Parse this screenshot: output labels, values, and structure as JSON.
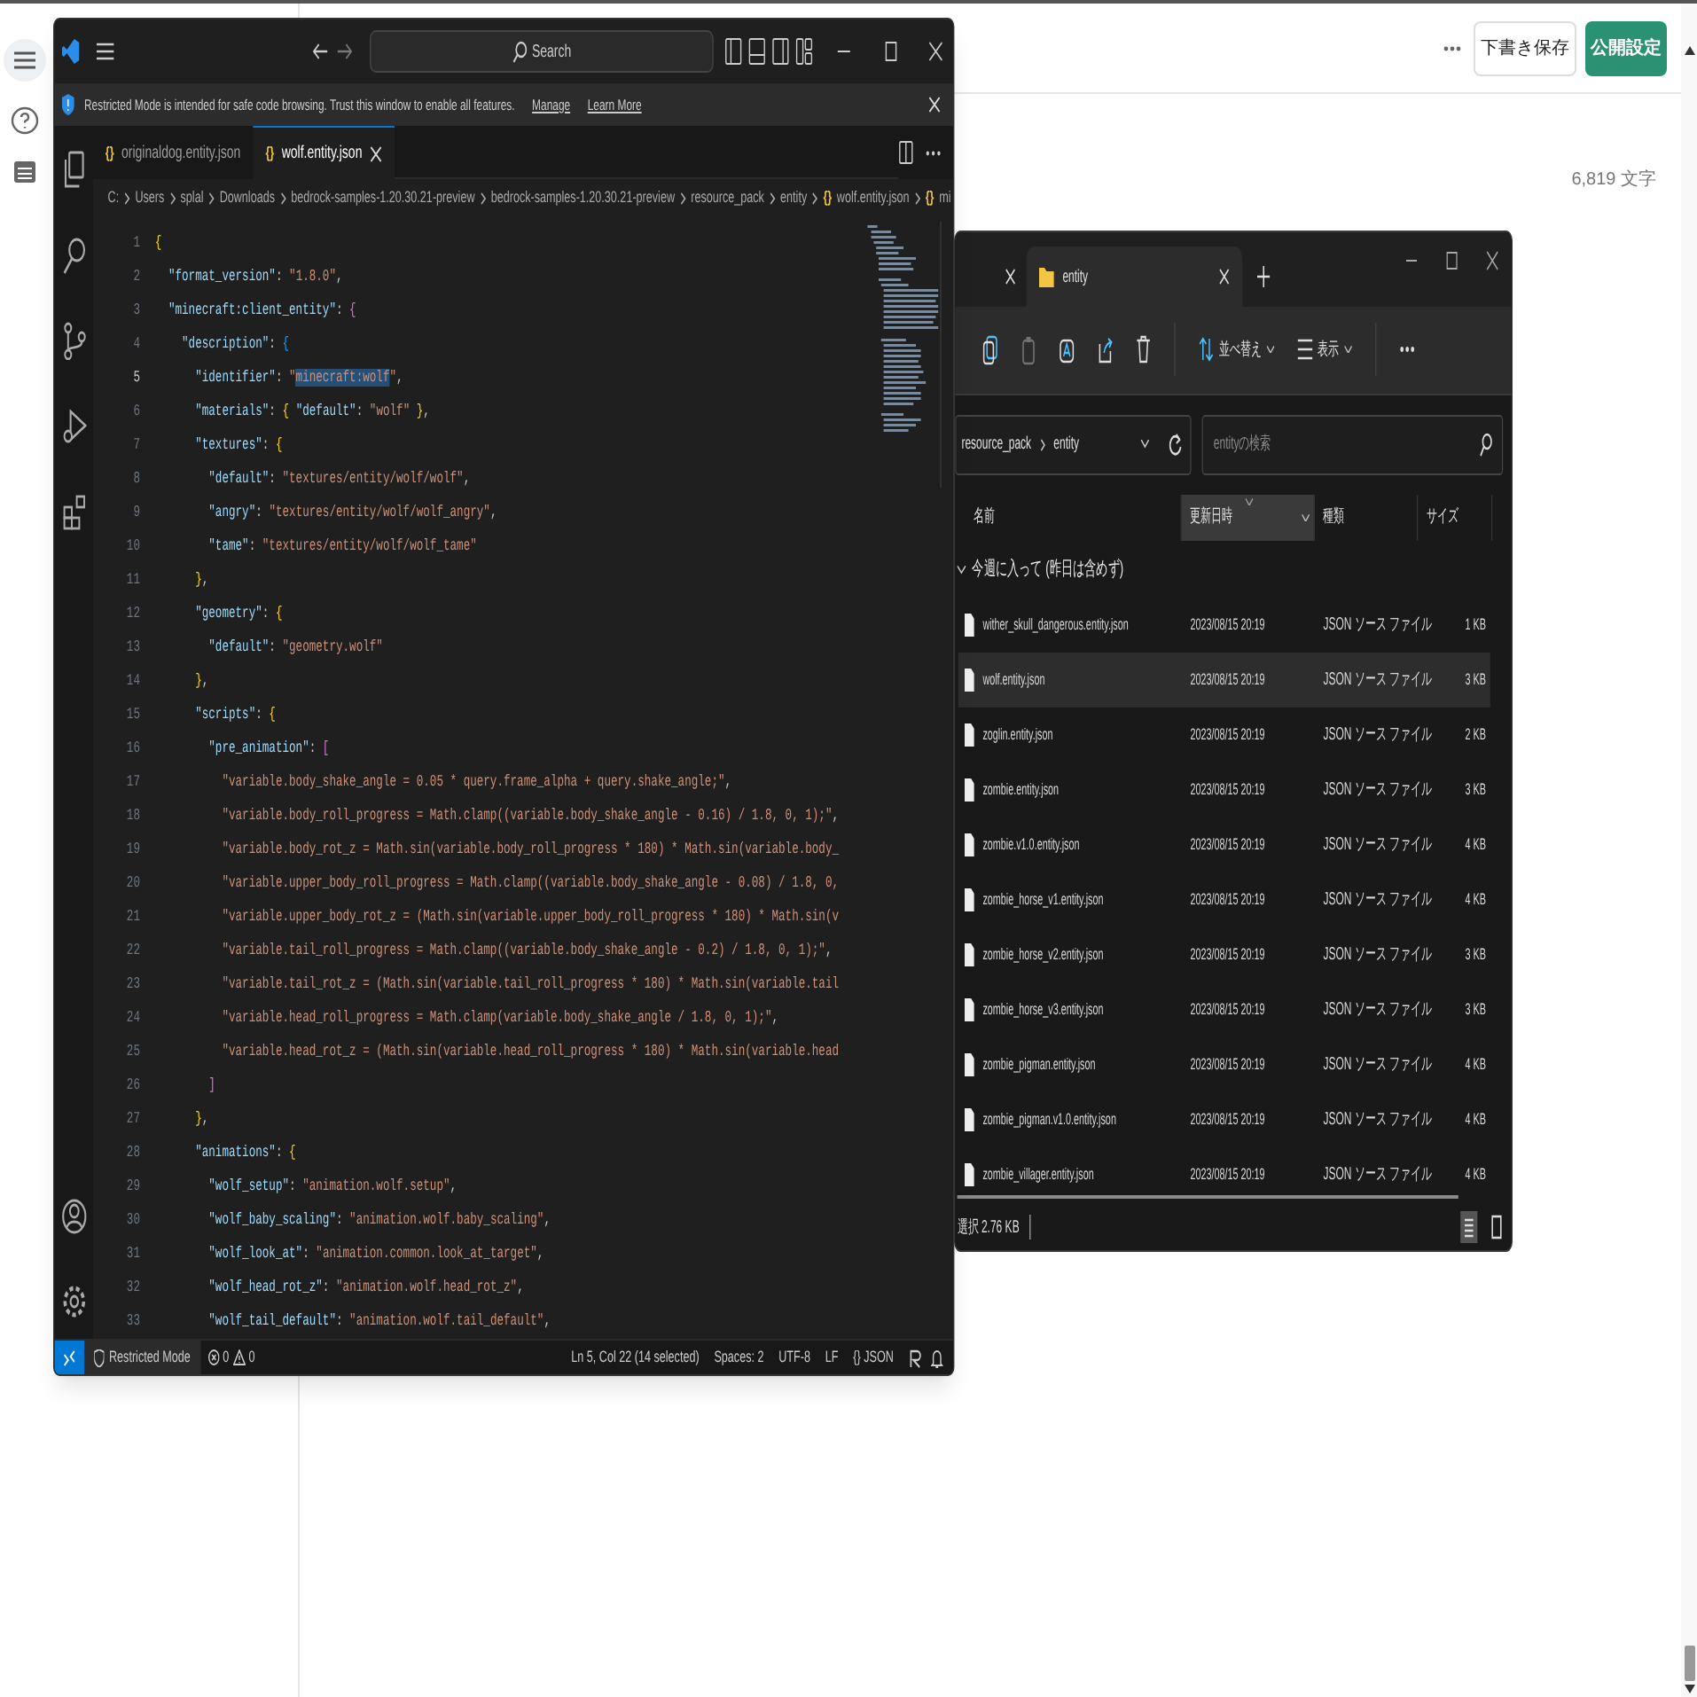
{
  "page": {
    "save_draft": "下書き保存",
    "publish": "公開設定",
    "char_count": "6,819 文字"
  },
  "vscode": {
    "search": "Search",
    "banner": {
      "message": "Restricted Mode is intended for safe code browsing. Trust this window to enable all features.",
      "links": [
        "Manage",
        "Learn More"
      ]
    },
    "tabs": [
      {
        "icon": "{}",
        "label": "originaldog.entity.json",
        "selected": false
      },
      {
        "icon": "{}",
        "label": "wolf.entity.json",
        "selected": true
      }
    ],
    "breadcrumb": [
      {
        "label": "C:"
      },
      {
        "label": "Users"
      },
      {
        "label": "splal"
      },
      {
        "label": "Downloads"
      },
      {
        "label": "bedrock-samples-1.20.30.21-preview"
      },
      {
        "label": "bedrock-samples-1.20.30.21-preview"
      },
      {
        "label": "resource_pack"
      },
      {
        "label": "entity"
      },
      {
        "icon": "{}",
        "label": "wolf.entity.json"
      },
      {
        "icon": "{}",
        "label": "mi"
      }
    ],
    "lines": [
      {
        "number": "1",
        "code": "{"
      },
      {
        "number": "2",
        "code": "  \"format_version\": \"1.8.0\","
      },
      {
        "number": "3",
        "code": "  \"minecraft:client_entity\": {"
      },
      {
        "number": "4",
        "code": "    \"description\": {"
      },
      {
        "number": "5",
        "kind": "selection",
        "code_before": "      \"identifier\": \"",
        "selected_text": "minecraft:wolf",
        "code_after": "\","
      },
      {
        "number": "6",
        "code": "      \"materials\": { \"default\": \"wolf\" },"
      },
      {
        "number": "7",
        "code": "      \"textures\": {"
      },
      {
        "number": "8",
        "code": "        \"default\": \"textures/entity/wolf/wolf\","
      },
      {
        "number": "9",
        "code": "        \"angry\": \"textures/entity/wolf/wolf_angry\","
      },
      {
        "number": "10",
        "code": "        \"tame\": \"textures/entity/wolf/wolf_tame\""
      },
      {
        "number": "11",
        "code": "      },"
      },
      {
        "number": "12",
        "code": "      \"geometry\": {"
      },
      {
        "number": "13",
        "code": "        \"default\": \"geometry.wolf\""
      },
      {
        "number": "14",
        "code": "      },"
      },
      {
        "number": "15",
        "code": "      \"scripts\": {"
      },
      {
        "number": "16",
        "code": "        \"pre_animation\": ["
      },
      {
        "number": "17",
        "code": "          \"variable.body_shake_angle = 0.05 * query.frame_alpha + query.shake_angle;\","
      },
      {
        "number": "18",
        "code": "          \"variable.body_roll_progress = Math.clamp((variable.body_shake_angle - 0.16) / 1.8, 0, 1);\","
      },
      {
        "number": "19",
        "code": "          \"variable.body_rot_z = Math.sin(variable.body_roll_progress * 180) * Math.sin(variable.body_"
      },
      {
        "number": "20",
        "code": "          \"variable.upper_body_roll_progress = Math.clamp((variable.body_shake_angle - 0.08) / 1.8, 0,"
      },
      {
        "number": "21",
        "code": "          \"variable.upper_body_rot_z = (Math.sin(variable.upper_body_roll_progress * 180) * Math.sin(v"
      },
      {
        "number": "22",
        "code": "          \"variable.tail_roll_progress = Math.clamp((variable.body_shake_angle - 0.2) / 1.8, 0, 1);\","
      },
      {
        "number": "23",
        "code": "          \"variable.tail_rot_z = (Math.sin(variable.tail_roll_progress * 180) * Math.sin(variable.tail"
      },
      {
        "number": "24",
        "code": "          \"variable.head_roll_progress = Math.clamp(variable.body_shake_angle / 1.8, 0, 1);\","
      },
      {
        "number": "25",
        "code": "          \"variable.head_rot_z = (Math.sin(variable.head_roll_progress * 180) * Math.sin(variable.head"
      },
      {
        "number": "26",
        "code": "        ]"
      },
      {
        "number": "27",
        "code": "      },"
      },
      {
        "number": "28",
        "code": "      \"animations\": {"
      },
      {
        "number": "29",
        "code": "        \"wolf_setup\": \"animation.wolf.setup\","
      },
      {
        "number": "30",
        "code": "        \"wolf_baby_scaling\": \"animation.wolf.baby_scaling\","
      },
      {
        "number": "31",
        "code": "        \"wolf_look_at\": \"animation.common.look_at_target\","
      },
      {
        "number": "32",
        "code": "        \"wolf_head_rot_z\": \"animation.wolf.head_rot_z\","
      },
      {
        "number": "33",
        "code": "        \"wolf_tail_default\": \"animation.wolf.tail_default\","
      }
    ],
    "status_bar": {
      "mode": "Restricted Mode",
      "errors": "0",
      "warnings": "0",
      "items": [
        "Ln 5, Col 22 (14 selected)",
        "Spaces: 2",
        "UTF-8",
        "LF",
        "{} JSON"
      ]
    }
  },
  "explorer": {
    "tab": {
      "label": "entity"
    },
    "toolbar": [
      {
        "kind": "copy",
        "disabled": false
      },
      {
        "kind": "paste",
        "disabled": true
      },
      {
        "kind": "rename",
        "disabled": false
      },
      {
        "kind": "share",
        "disabled": false
      },
      {
        "kind": "delete",
        "disabled": false
      }
    ],
    "sort": "並べ替え",
    "view": "表示",
    "path": [
      "resource_pack",
      "entity"
    ],
    "search_placeholder": "entityの検索",
    "columns": [
      {
        "label": "名前",
        "sorted": false
      },
      {
        "label": "更新日時",
        "sorted": true
      },
      {
        "label": "種類",
        "sorted": false
      },
      {
        "label": "サイズ",
        "sorted": false
      }
    ],
    "group": "今週に入って (昨日は含めず)",
    "rows": [
      {
        "name": "wither_skull_dangerous.entity.json",
        "date": "2023/08/15 20:19",
        "type": "JSON ソース ファイル",
        "size": "1 KB",
        "selected": false
      },
      {
        "name": "wolf.entity.json",
        "date": "2023/08/15 20:19",
        "type": "JSON ソース ファイル",
        "size": "3 KB",
        "selected": true
      },
      {
        "name": "zoglin.entity.json",
        "date": "2023/08/15 20:19",
        "type": "JSON ソース ファイル",
        "size": "2 KB",
        "selected": false
      },
      {
        "name": "zombie.entity.json",
        "date": "2023/08/15 20:19",
        "type": "JSON ソース ファイル",
        "size": "3 KB",
        "selected": false
      },
      {
        "name": "zombie.v1.0.entity.json",
        "date": "2023/08/15 20:19",
        "type": "JSON ソース ファイル",
        "size": "4 KB",
        "selected": false
      },
      {
        "name": "zombie_horse_v1.entity.json",
        "date": "2023/08/15 20:19",
        "type": "JSON ソース ファイル",
        "size": "4 KB",
        "selected": false
      },
      {
        "name": "zombie_horse_v2.entity.json",
        "date": "2023/08/15 20:19",
        "type": "JSON ソース ファイル",
        "size": "3 KB",
        "selected": false
      },
      {
        "name": "zombie_horse_v3.entity.json",
        "date": "2023/08/15 20:19",
        "type": "JSON ソース ファイル",
        "size": "3 KB",
        "selected": false
      },
      {
        "name": "zombie_pigman.entity.json",
        "date": "2023/08/15 20:19",
        "type": "JSON ソース ファイル",
        "size": "4 KB",
        "selected": false
      },
      {
        "name": "zombie_pigman.v1.0.entity.json",
        "date": "2023/08/15 20:19",
        "type": "JSON ソース ファイル",
        "size": "4 KB",
        "selected": false
      },
      {
        "name": "zombie_villager.entity.json",
        "date": "2023/08/15 20:19",
        "type": "JSON ソース ファイル",
        "size": "4 KB",
        "selected": false
      }
    ],
    "status": "選択 2.76 KB",
    "view_modes": [
      {
        "kind": "details",
        "selected": true
      },
      {
        "kind": "tiles",
        "selected": false
      }
    ]
  }
}
